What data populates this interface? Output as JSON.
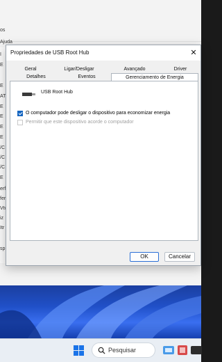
{
  "background_window": {
    "menu_fragments": [
      "os",
      "Ajuda"
    ],
    "side_fragments": [
      "I",
      "E",
      "E",
      "AT",
      "E",
      "E",
      "E",
      "E",
      "/C",
      "/C",
      "/C",
      "E",
      "erf",
      "fer",
      "Vtw",
      "iz",
      "Itr",
      "sp"
    ]
  },
  "dialog": {
    "title": "Propriedades de USB Root Hub",
    "close_symbol": "✕",
    "tabs_top": [
      "Geral",
      "Ligar/Desligar",
      "Avançado",
      "Driver"
    ],
    "tabs_bottom": [
      "Detalhes",
      "Eventos",
      "Gerenciamento de Energia"
    ],
    "active_tab": "Gerenciamento de Energia",
    "device_name": "USB Root Hub",
    "options": [
      {
        "label": "O computador pode desligar o dispositivo para economizar energia",
        "checked": true,
        "enabled": true
      },
      {
        "label": "Permitir que este dispositivo acorde o computador",
        "checked": false,
        "enabled": false
      }
    ],
    "ok_label": "OK",
    "cancel_label": "Cancelar"
  },
  "taskbar": {
    "search_label": "Pesquisar"
  },
  "colors": {
    "accent": "#1565c0",
    "wallpaper": "#2050c8"
  }
}
